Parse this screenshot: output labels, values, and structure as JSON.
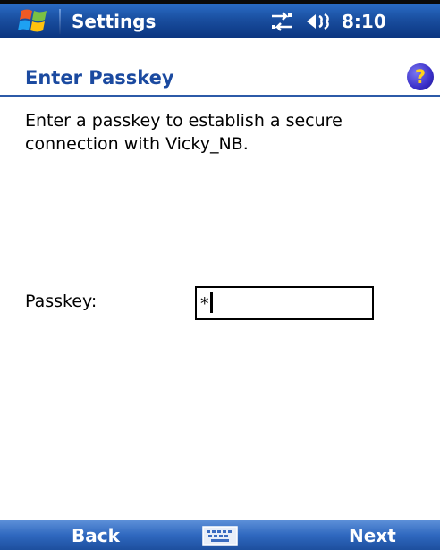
{
  "titlebar": {
    "app_title": "Settings",
    "time": "8:10",
    "icons": [
      "windows-start-icon",
      "connectivity-icon",
      "volume-icon"
    ]
  },
  "header": {
    "title": "Enter Passkey",
    "help_label": "?"
  },
  "content": {
    "message": "Enter a passkey to establish a secure connection with Vicky_NB.",
    "passkey_label": "Passkey:",
    "passkey_value": "*"
  },
  "softkeys": {
    "left": "Back",
    "right": "Next",
    "center_icon": "keyboard-icon"
  },
  "colors": {
    "titlebar": "#1a4fa0",
    "header_text": "#1b4aa0",
    "softbar": "#2f68bf"
  }
}
